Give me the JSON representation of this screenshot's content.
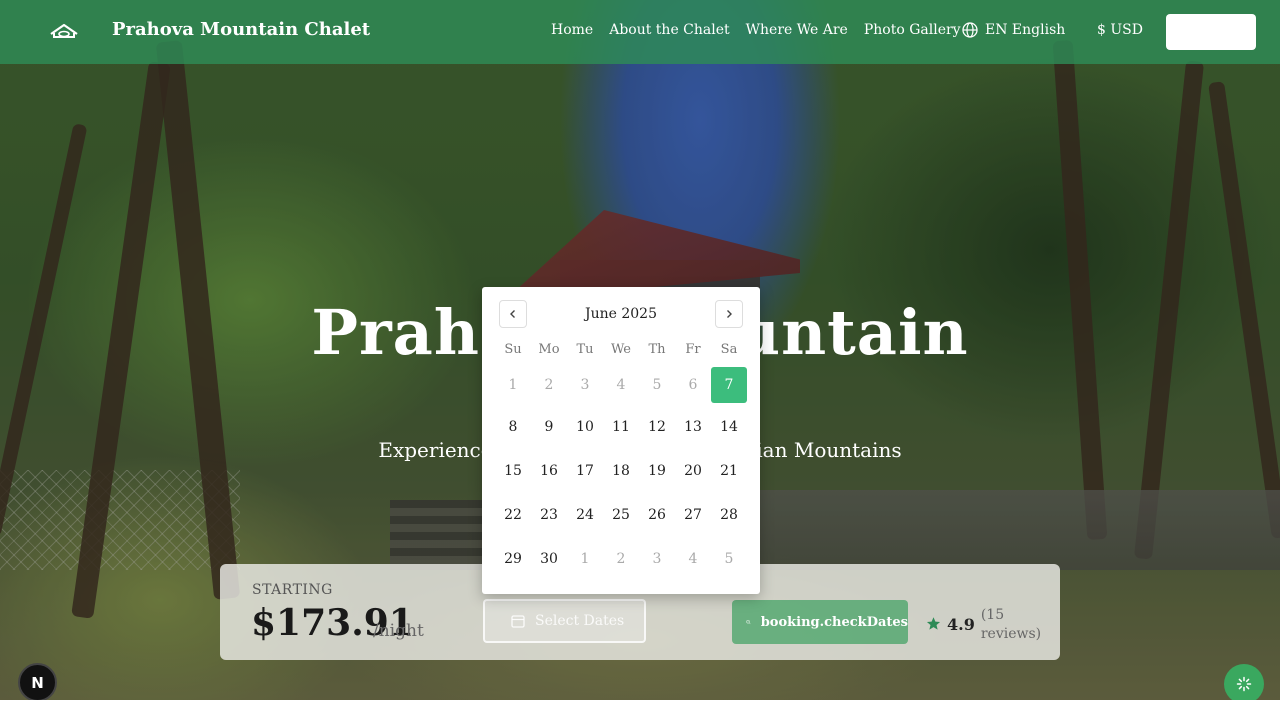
{
  "header": {
    "brand": "Prahova Mountain Chalet",
    "nav": [
      "Home",
      "About the Chalet",
      "Where We Are",
      "Photo Gallery"
    ],
    "language": "EN English",
    "currency": "$ USD",
    "button_label": ""
  },
  "hero": {
    "title": "Prahova Mountain",
    "subtitle": "Experience the charm of the Carpathian Mountains"
  },
  "booking": {
    "starting_label": "STARTING",
    "price": "$173.91",
    "per_night": "/night",
    "date_button": "Select Dates",
    "check_button": "booking.checkDates",
    "rating": "4.9",
    "review_count": "(15 reviews)"
  },
  "calendar": {
    "month": "June 2025",
    "weekdays": [
      "Su",
      "Mo",
      "Tu",
      "We",
      "Th",
      "Fr",
      "Sa"
    ],
    "weeks": [
      [
        "1",
        "2",
        "3",
        "4",
        "5",
        "6",
        "7"
      ],
      [
        "8",
        "9",
        "10",
        "11",
        "12",
        "13",
        "14"
      ],
      [
        "15",
        "16",
        "17",
        "18",
        "19",
        "20",
        "21"
      ],
      [
        "22",
        "23",
        "24",
        "25",
        "26",
        "27",
        "28"
      ],
      [
        "29",
        "30",
        "1",
        "2",
        "3",
        "4",
        "5"
      ]
    ],
    "selected": "7"
  },
  "badge": "N",
  "colors": {
    "header": "#2e8b57",
    "accent": "#3cbd7d"
  }
}
